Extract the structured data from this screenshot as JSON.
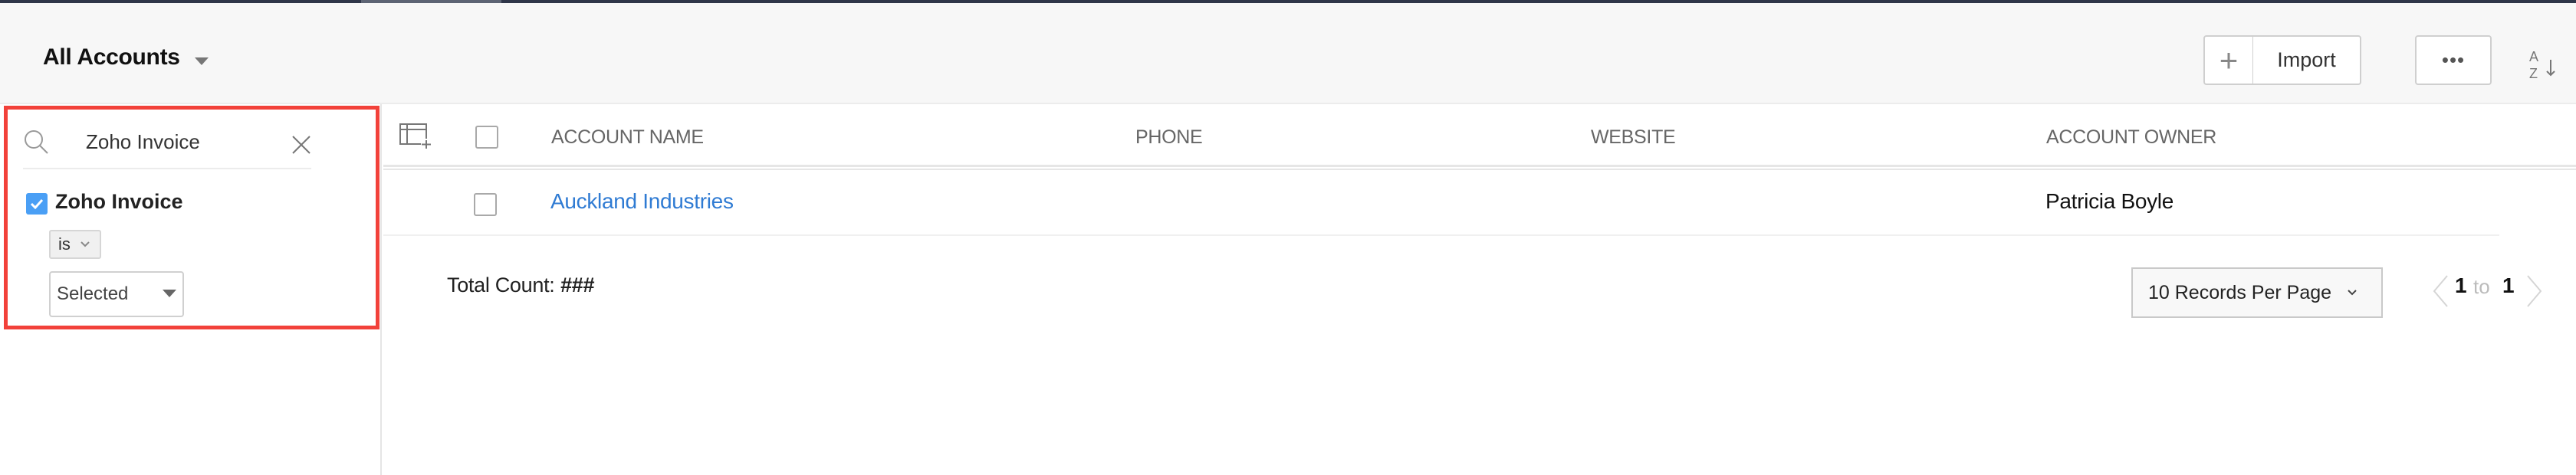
{
  "header": {
    "view_title": "All Accounts",
    "add_icon": "plus-icon",
    "import_label": "Import",
    "more_label": "•••",
    "sort_icon": "sort-az-icon"
  },
  "sidebar": {
    "search": {
      "value": "Zoho Invoice",
      "icon": "search-icon",
      "clear_icon": "close-icon"
    },
    "filter": {
      "label": "Zoho Invoice",
      "checked": true,
      "operator": "is",
      "value": "Selected"
    },
    "highlight_color": "#f2413a"
  },
  "table": {
    "columns": [
      "ACCOUNT NAME",
      "PHONE",
      "WEBSITE",
      "ACCOUNT OWNER"
    ],
    "rows": [
      {
        "account_name": "Auckland Industries",
        "phone": "",
        "website": "",
        "account_owner": "Patricia Boyle"
      }
    ],
    "link_color": "#2f7bd3"
  },
  "footer": {
    "total_label": "Total Count:",
    "total_value": "###",
    "per_page": "10 Records Per Page",
    "page_from": "1",
    "page_to_label": "to",
    "page_total": "1"
  }
}
